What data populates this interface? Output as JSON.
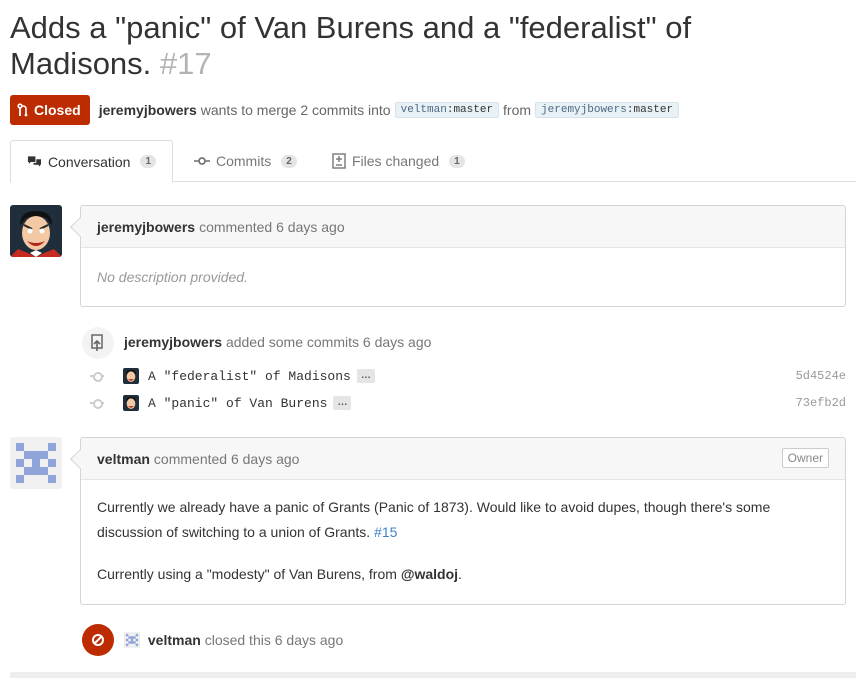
{
  "pr": {
    "title": "Adds a \"panic\" of Van Burens and a \"federalist\" of Madisons.",
    "number": "#17",
    "state": "Closed",
    "author": "jeremyjbowers",
    "merge_text": "wants to merge 2 commits into",
    "base_repo": "veltman",
    "base_branch": "master",
    "from_text": "from",
    "head_repo": "jeremyjbowers",
    "head_branch": "master",
    "sep": ":"
  },
  "tabs": [
    {
      "label": "Conversation",
      "count": "1",
      "icon": "comment-discussion-icon",
      "active": true
    },
    {
      "label": "Commits",
      "count": "2",
      "icon": "git-commit-icon",
      "active": false
    },
    {
      "label": "Files changed",
      "count": "1",
      "icon": "diff-icon",
      "active": false
    }
  ],
  "timeline": {
    "comment1": {
      "author": "jeremyjbowers",
      "action": "commented",
      "time": "6 days ago",
      "body": "No description provided."
    },
    "commits_event": {
      "author": "jeremyjbowers",
      "action": "added some commits",
      "time": "6 days ago",
      "commits": [
        {
          "message": "A \"federalist\" of Madisons",
          "sha": "5d4524e"
        },
        {
          "message": "A \"panic\" of Van Burens",
          "sha": "73efb2d"
        }
      ],
      "ellipsis": "…"
    },
    "comment2": {
      "author": "veltman",
      "action": "commented",
      "time": "6 days ago",
      "badge": "Owner",
      "para1_text": "Currently we already have a panic of Grants (Panic of 1873). Would like to avoid dupes, though there's some discussion of switching to a union of Grants.",
      "para1_link": "#15",
      "para2_pre": "Currently using a \"modesty\" of Van Burens, from",
      "para2_mention": "@waldoj",
      "para2_post": "."
    },
    "closed_event": {
      "author": "veltman",
      "action": "closed this",
      "time": "6 days ago"
    }
  },
  "colors": {
    "closed_red": "#bd2c00",
    "link_blue": "#4183c4",
    "identicon_blue": "#8fa4d8"
  }
}
